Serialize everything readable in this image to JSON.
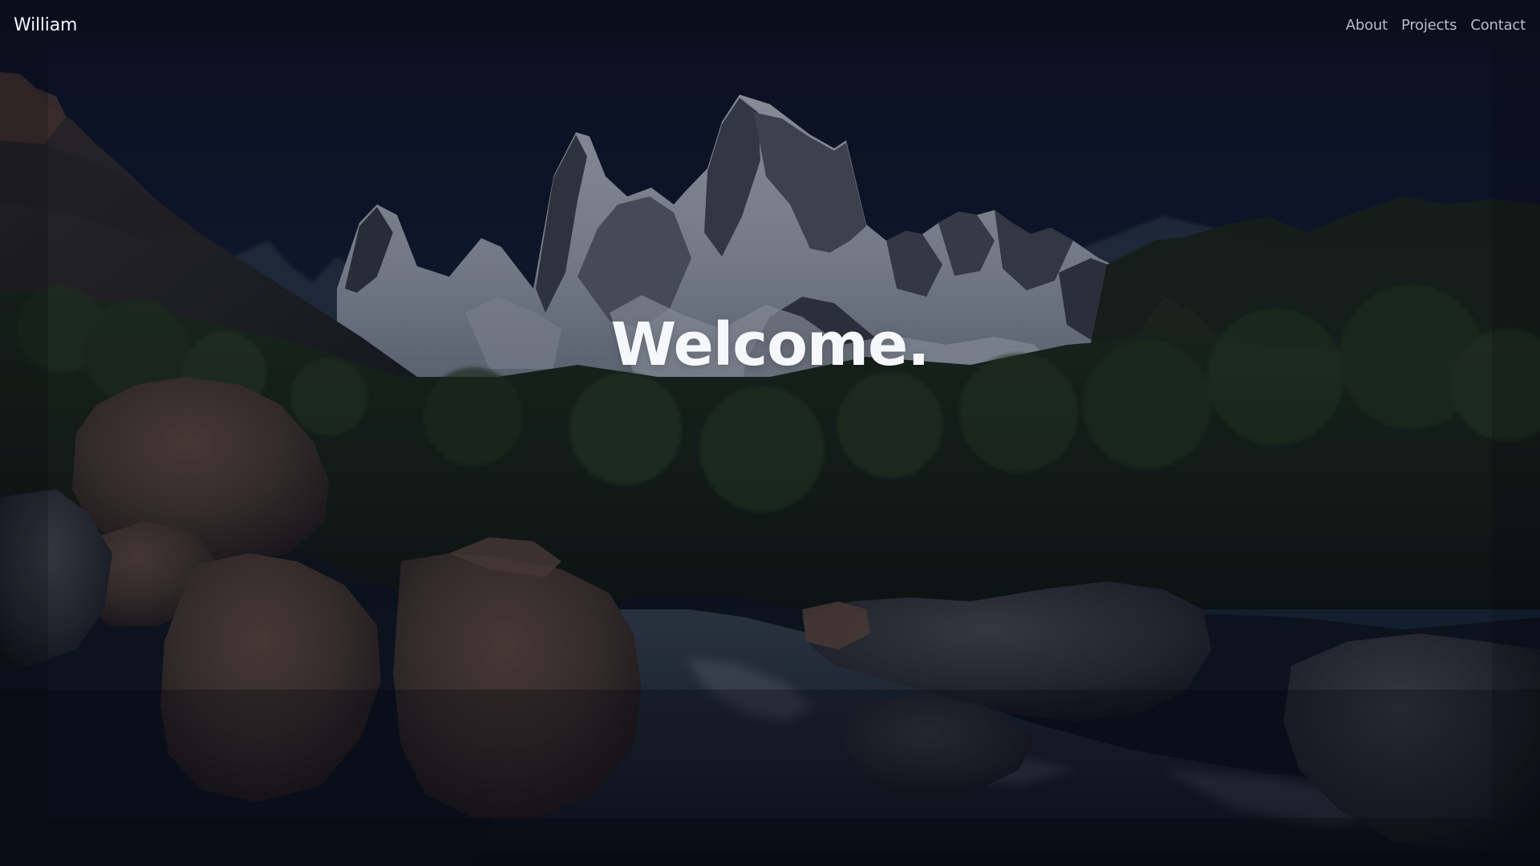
{
  "navbar": {
    "brand": "William",
    "links": [
      {
        "label": "About"
      },
      {
        "label": "Projects"
      },
      {
        "label": "Contact"
      }
    ]
  },
  "hero": {
    "title": "Welcome."
  },
  "icons": {
    "background": "mountain-river-landscape"
  },
  "colors": {
    "sky_top": "#101628",
    "sky_mid": "#18243e",
    "nav_text": "#b6bdc9",
    "brand_text": "#f3f5fb",
    "hero_text": "#f6f7fb"
  }
}
